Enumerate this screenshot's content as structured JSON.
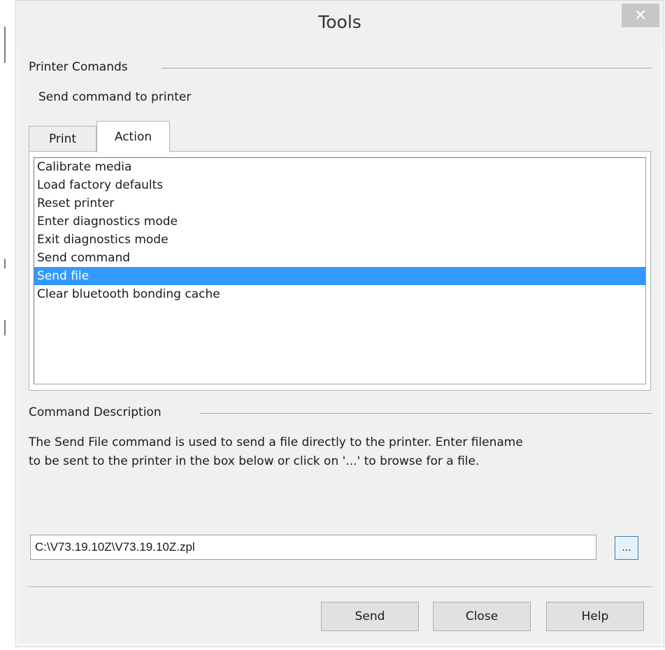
{
  "window": {
    "title": "Tools",
    "close_glyph": "✕"
  },
  "printer_commands": {
    "group_label": "Printer Comands",
    "subtitle": "Send command to printer"
  },
  "tabs": [
    {
      "label": "Print",
      "active": false
    },
    {
      "label": "Action",
      "active": true
    }
  ],
  "action_list": {
    "items": [
      "Calibrate media",
      "Load factory defaults",
      "Reset printer",
      "Enter diagnostics mode",
      "Exit diagnostics mode",
      "Send command",
      "Send file",
      "Clear bluetooth bonding cache"
    ],
    "selected": "Send file"
  },
  "command_description": {
    "group_label": "Command Description",
    "line1": "The Send File command is used to send a file directly to the printer. Enter filename",
    "line2": "to be sent to the printer in the box below or click on '...' to browse for a file."
  },
  "file": {
    "path": "C:\\V73.19.10Z\\V73.19.10Z.zpl",
    "browse_label": "..."
  },
  "buttons": {
    "send": "Send",
    "close": "Close",
    "help": "Help"
  },
  "colors": {
    "selection": "#3399ff",
    "close_button": "#c7c7c7",
    "browse_border": "#3c7fb1"
  },
  "icons": {
    "close": "close-icon"
  }
}
